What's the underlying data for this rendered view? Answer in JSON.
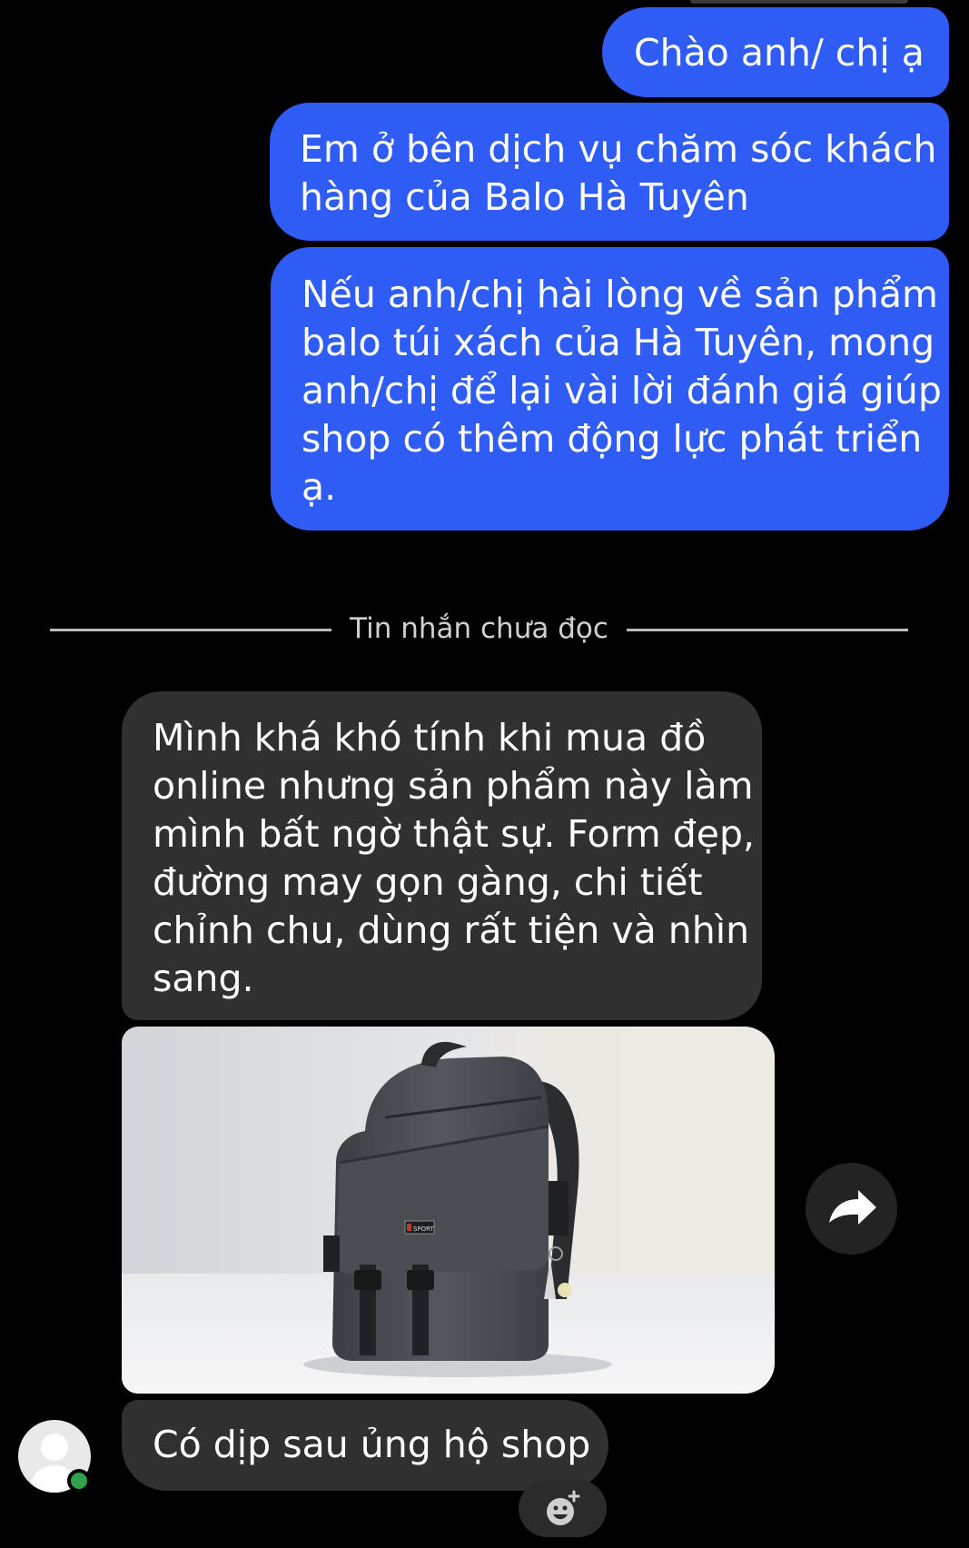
{
  "chat": {
    "outgoing": [
      {
        "lines": [
          "Chào anh/ chị ạ"
        ]
      },
      {
        "lines": [
          "Em ở bên dịch vụ chăm sóc khách",
          "hàng của Balo Hà Tuyên"
        ]
      },
      {
        "lines": [
          "Nếu anh/chị hài lòng về sản phẩm",
          "balo túi xách của Hà Tuyên, mong",
          "anh/chị để lại vài lời đánh giá giúp",
          "shop có thêm động lực phát triển",
          "ạ."
        ]
      }
    ],
    "unread_divider": "Tin nhắn chưa đọc",
    "incoming": [
      {
        "lines": [
          "Mình khá khó tính khi mua đồ",
          "online nhưng sản phẩm này làm",
          "mình bất ngờ thật sự. Form đẹp,",
          "đường may gọn gàng, chi tiết",
          "chỉnh chu, dùng rất tiện và nhìn",
          "sang."
        ]
      },
      {
        "lines": [
          "Có dịp sau ủng hộ shop"
        ]
      }
    ],
    "photo": {
      "badge_text": "SPORT"
    }
  },
  "icons": {
    "forward": "share-arrow-icon",
    "avatar": "default-user-avatar-icon",
    "online": "online-status-dot",
    "reaction": "add-reaction-emoji-icon"
  },
  "colors": {
    "outgoing_bubble": "#2f5cf5",
    "incoming_bubble": "#303030",
    "background": "#000000",
    "online_dot": "#31a24c"
  }
}
